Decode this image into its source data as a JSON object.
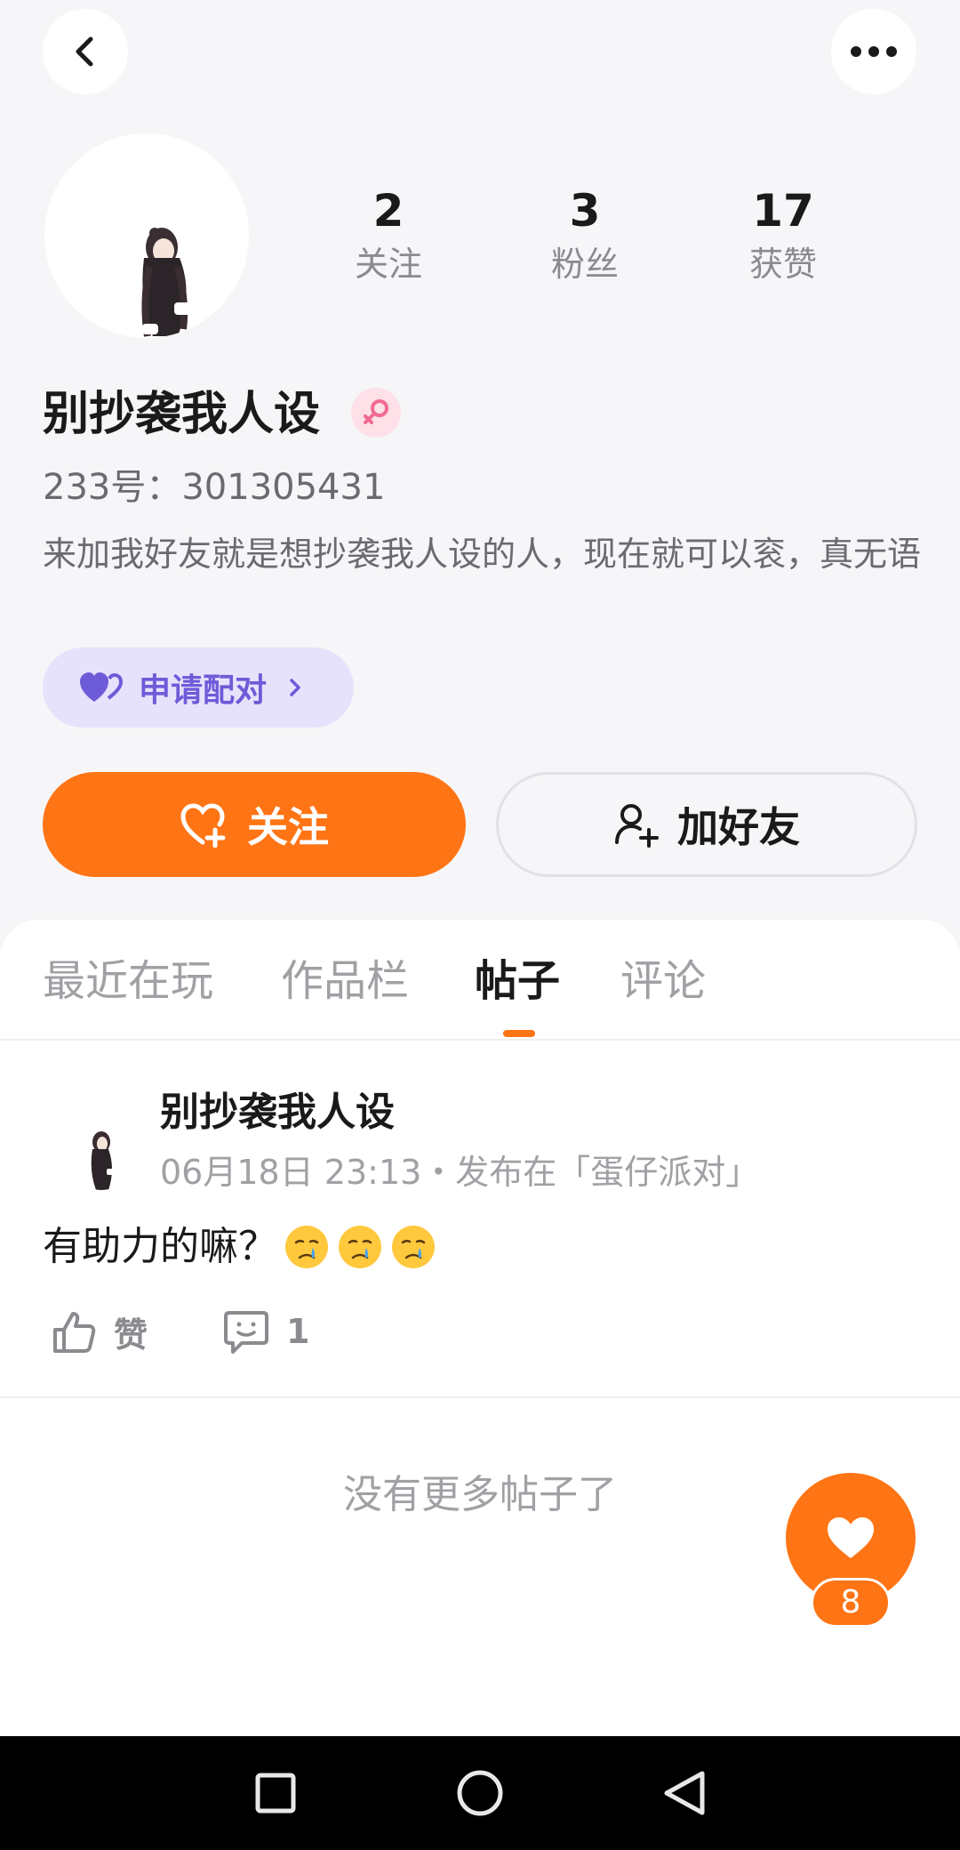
{
  "colors": {
    "accent": "#ff7414",
    "pair_bg": "#e6e2fb",
    "pair_text": "#6d5bd8",
    "gender_badge": "#fde0e8",
    "muted_text": "#a0a0a5"
  },
  "header": {
    "back_icon": "chevron-left-icon",
    "more_icon": "more-horizontal-icon"
  },
  "profile": {
    "stats": [
      {
        "value": "2",
        "label": "关注"
      },
      {
        "value": "3",
        "label": "粉丝"
      },
      {
        "value": "17",
        "label": "获赞"
      }
    ],
    "nickname": "别抄袭我人设",
    "gender_icon": "female-icon",
    "user_id": "233号：301305431",
    "bio": "来加我好友就是想抄袭我人设的人，现在就可以衮，真无语",
    "pair_button": "申请配对",
    "follow_button": "关注",
    "add_friend_button": "加好友"
  },
  "tabs": [
    {
      "label": "最近在玩",
      "active": false
    },
    {
      "label": "作品栏",
      "active": false
    },
    {
      "label": "帖子",
      "active": true
    },
    {
      "label": "评论",
      "active": false
    }
  ],
  "post": {
    "author": "别抄袭我人设",
    "meta": "06月18日 23:13・发布在「蛋仔派对」",
    "text": "有助力的嘛？",
    "emojis": [
      "crying-face",
      "crying-face",
      "crying-face"
    ],
    "like_label": "赞",
    "comment_count": "1"
  },
  "footer_text": "没有更多帖子了",
  "fab": {
    "icon": "heart-icon",
    "count": "8"
  },
  "system_nav": [
    "recent-apps-icon",
    "home-icon",
    "back-icon"
  ]
}
